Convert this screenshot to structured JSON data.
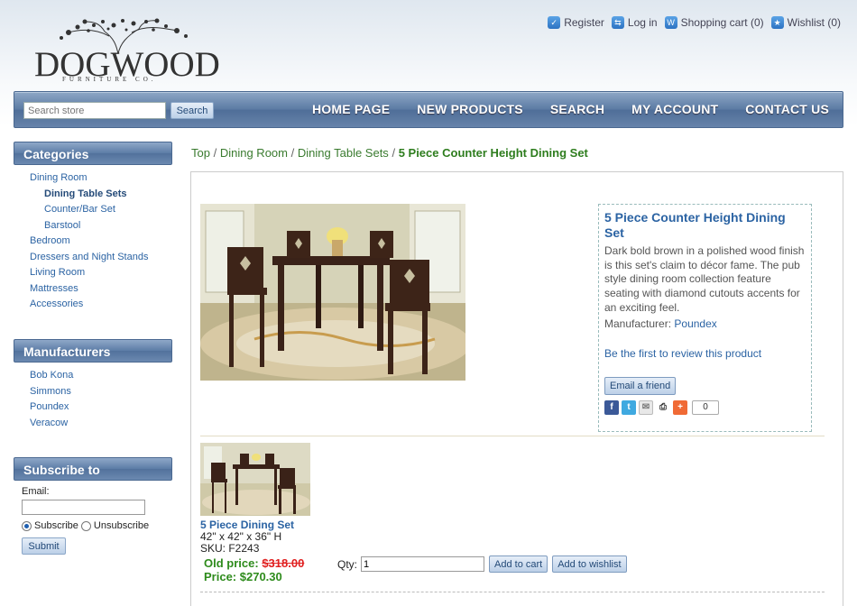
{
  "logo": {
    "name": "DOGWOOD",
    "tagline": "FURNITURE CO."
  },
  "top_links": [
    {
      "label": "Register",
      "icon": "register-icon"
    },
    {
      "label": "Log in",
      "icon": "login-icon"
    },
    {
      "label": "Shopping cart (0)",
      "icon": "cart-icon"
    },
    {
      "label": "Wishlist (0)",
      "icon": "wishlist-icon"
    }
  ],
  "search": {
    "placeholder": "Search store",
    "button": "Search"
  },
  "nav": [
    "HOME PAGE",
    "NEW PRODUCTS",
    "SEARCH",
    "MY ACCOUNT",
    "CONTACT US"
  ],
  "categories": {
    "title": "Categories",
    "items": [
      {
        "label": "Dining Room"
      },
      {
        "label": "Dining Table Sets"
      },
      {
        "label": "Counter/Bar Set"
      },
      {
        "label": "Barstool"
      },
      {
        "label": "Bedroom"
      },
      {
        "label": "Dressers and Night Stands"
      },
      {
        "label": "Living Room"
      },
      {
        "label": "Mattresses"
      },
      {
        "label": "Accessories"
      }
    ]
  },
  "manufacturers": {
    "title": "Manufacturers",
    "items": [
      {
        "label": "Bob Kona"
      },
      {
        "label": "Simmons"
      },
      {
        "label": "Poundex"
      },
      {
        "label": "Veracow"
      }
    ]
  },
  "newsletter": {
    "title": "Subscribe to newsletters",
    "email_label": "Email:",
    "subscribe": "Subscribe",
    "unsubscribe": "Unsubscribe",
    "submit": "Submit"
  },
  "breadcrumb": {
    "top": "Top",
    "sep": "/",
    "level1": "Dining Room",
    "level2": "Dining Table Sets",
    "current": "5 Piece Counter Height Dining Set"
  },
  "product": {
    "name": "5 Piece Counter Height Dining Set",
    "description": "Dark bold brown in a polished wood finish is this set's claim to décor fame. The pub style dining room collection feature seating with diamond cutouts accents for an exciting feel.",
    "manufacturer_label": "Manufacturer:",
    "manufacturer": "Poundex",
    "review_link": "Be the first to review this product",
    "email_friend": "Email a friend",
    "share_count": "0"
  },
  "variant": {
    "name": "5 Piece Dining Set",
    "dimensions": "42\" x 42\" x 36\" H",
    "sku": "SKU: F2243",
    "old_price_label": "Old price:",
    "old_price": "$318.00",
    "price_label": "Price:",
    "price": "$270.30",
    "qty_label": "Qty:",
    "qty": "1",
    "add_to_cart": "Add to cart",
    "add_to_wishlist": "Add to wishlist"
  }
}
